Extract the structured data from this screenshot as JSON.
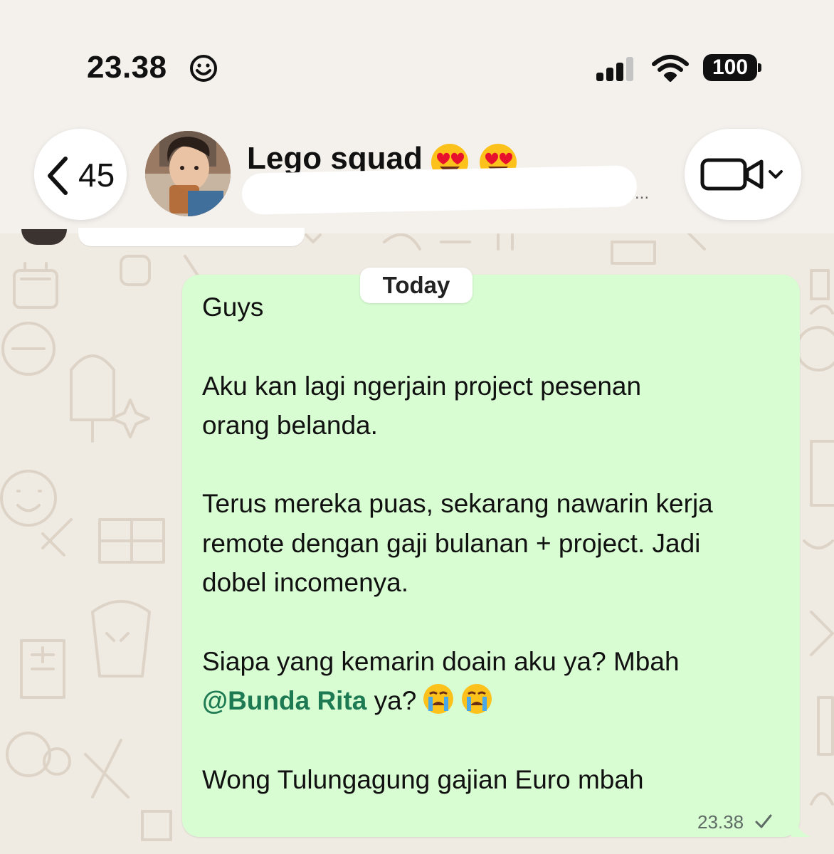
{
  "status_bar": {
    "time": "23.38",
    "battery": "100"
  },
  "header": {
    "back_count": "45",
    "group_name": "Lego squad",
    "subtitle_ellipsis": "..."
  },
  "chat": {
    "date_label": "Today",
    "message": {
      "line1": "Guys",
      "para2": "Aku kan lagi ngerjain project pesenan\norang belanda.",
      "para3": "Terus mereka puas, sekarang nawarin kerja\nremote dengan gaji bulanan + project. Jadi\ndobel incomenya.",
      "para4_start": "Siapa yang kemarin doain aku ya? Mbah",
      "mention": "@Bunda Rita",
      "para4_end": " ya?",
      "para5": "Wong Tulungagung gajian Euro mbah",
      "time": "23.38"
    }
  },
  "colors": {
    "bubble": "#d9fdd3",
    "mention": "#1d7a52",
    "wallpaper": "#efeae2"
  },
  "icons": [
    "smiley-icon",
    "signal-icon",
    "wifi-icon",
    "chevron-left-icon",
    "heart-eyes-emoji",
    "video-camera-icon",
    "chevron-down-icon",
    "crying-emoji",
    "checkmark-icon"
  ]
}
